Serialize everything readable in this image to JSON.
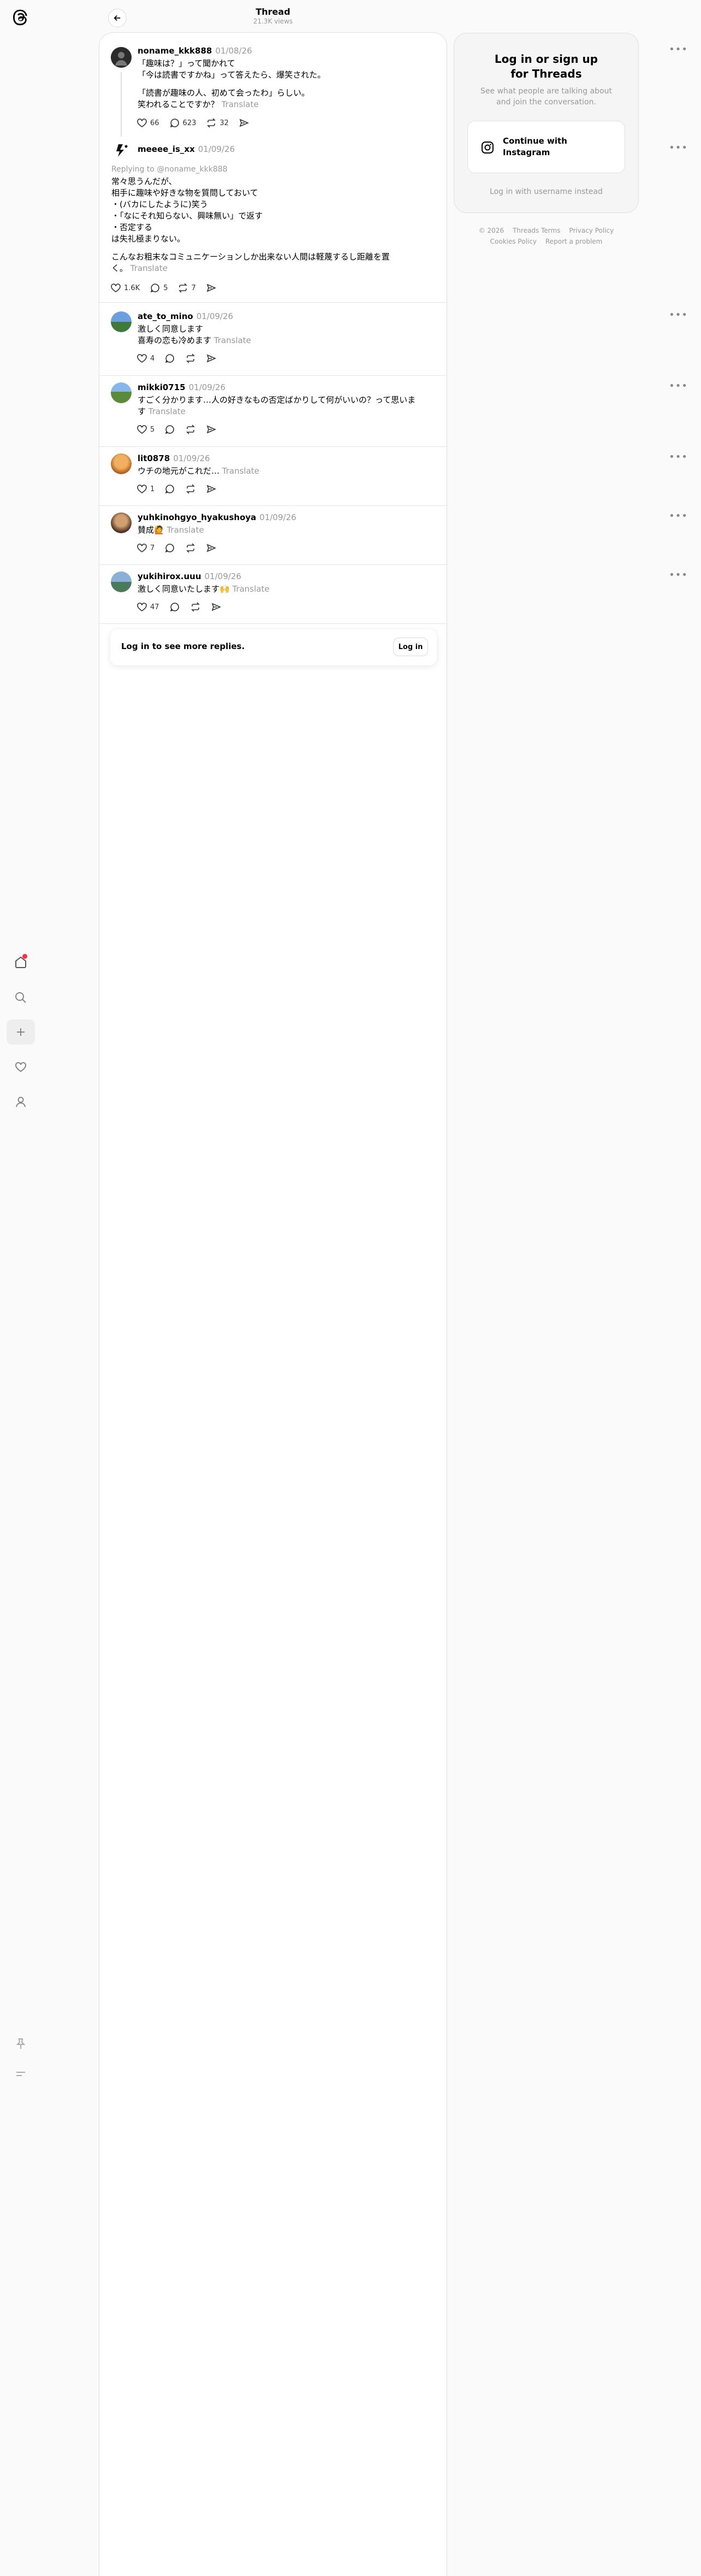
{
  "header": {
    "title": "Thread",
    "views": "21.3K views"
  },
  "posts": [
    {
      "username": "noname_kkk888",
      "date": "01/08/26",
      "lines": [
        "「趣味は？」って聞かれて",
        "「今は読書ですかね」って答えたら、爆笑された。"
      ],
      "lines2": [
        "「読書が趣味の人、初めて会ったわ」らしい。"
      ],
      "last_line": "笑われることですか？",
      "translate": "Translate",
      "likes": "66",
      "replies": "623",
      "reposts": "32"
    },
    {
      "username": "meeee_is_xx",
      "date": "01/09/26",
      "replying": "Replying to @noname_kkk888",
      "lines": [
        "常々思うんだが、",
        "相手に趣味や好きな物を質問しておいて",
        "・(バカにしたように)笑う",
        "・「なにそれ知らない、興味無い」で返す",
        "・否定する",
        "は失礼極まりない。"
      ],
      "lines2": [
        "こんなお粗末なコミュニケーションしか出来ない人間は軽蔑するし距離を置"
      ],
      "last_line": "く。",
      "translate": "Translate",
      "likes": "1.6K",
      "replies": "5",
      "reposts": "7"
    },
    {
      "username": "ate_to_mino",
      "date": "01/09/26",
      "lines": [
        "激しく同意します"
      ],
      "last_line": "喜寿の恋も冷めます",
      "translate": "Translate",
      "likes": "4"
    },
    {
      "username": "mikki0715",
      "date": "01/09/26",
      "lines": [
        "すごく分かります…人の好きなもの否定ばかりして何がいいの？って思いま"
      ],
      "last_line": "す",
      "translate": "Translate",
      "likes": "5"
    },
    {
      "username": "lit0878",
      "date": "01/09/26",
      "lines": [],
      "last_line": "ウチの地元がこれだ…",
      "translate": "Translate",
      "likes": "1"
    },
    {
      "username": "yuhkinohgyo_hyakushoya",
      "date": "01/09/26",
      "lines": [],
      "last_line": "賛成🙋",
      "translate": "Translate",
      "likes": "7"
    },
    {
      "username": "yukihirox.uuu",
      "date": "01/09/26",
      "lines": [],
      "last_line": "激しく同意いたします🙌",
      "translate": "Translate",
      "likes": "47"
    }
  ],
  "more_replies": {
    "message": "Log in to see more replies.",
    "button": "Log in"
  },
  "login_panel": {
    "title": "Log in or sign up\nfor Threads",
    "subtitle": "See what people are talking about\nand join the conversation.",
    "instagram_button": "Continue with\nInstagram",
    "alt_login": "Log in with username instead"
  },
  "footer": {
    "copyright": "© 2026",
    "terms": "Threads Terms",
    "privacy": "Privacy Policy",
    "cookies": "Cookies Policy",
    "report": "Report a problem"
  },
  "icons": [
    "threads-logo-icon",
    "home-icon",
    "search-icon",
    "create-icon",
    "heart-icon",
    "profile-icon",
    "pin-icon",
    "menu-icon"
  ],
  "colors": {
    "notification": "#ff3040",
    "muted": "#999999"
  }
}
